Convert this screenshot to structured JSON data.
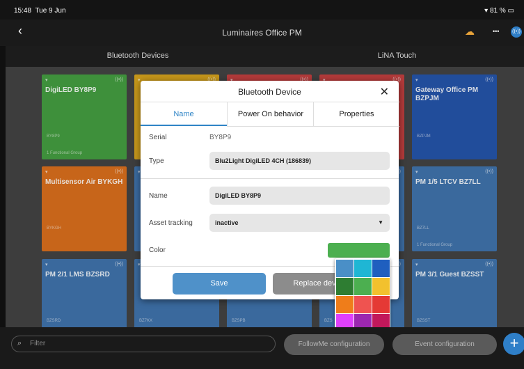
{
  "status_bar": {
    "time": "15:48",
    "date": "Tue 9 Jun",
    "battery": "81 %"
  },
  "header": {
    "title": "Luminaires Office PM",
    "back_icon": "chevron-left-icon",
    "more": "•••"
  },
  "tabs": [
    "Bluetooth Devices",
    "LiNA Touch"
  ],
  "tiles": [
    {
      "name": "DigiLED BY8P9",
      "serial": "BY8P9",
      "group": "1 Functional Group",
      "color": "#3f9a3b"
    },
    {
      "name": "",
      "serial": "",
      "group": "",
      "color": "#d4a017"
    },
    {
      "name": "",
      "serial": "",
      "group": "",
      "color": "#c03a3a"
    },
    {
      "name": "",
      "serial": "",
      "group": "",
      "color": "#c03a3a"
    },
    {
      "name": "Gateway Office PM BZPJM",
      "serial": "BZPJM",
      "group": "",
      "color": "#1f4fa6"
    },
    {
      "name": "Multisensor Air BYKGH",
      "serial": "BYKGH",
      "group": "",
      "color": "#d66a17"
    },
    {
      "name": "",
      "serial": "",
      "group": "",
      "color": "#3a6ea8"
    },
    {
      "name": "",
      "serial": "",
      "group": "",
      "color": "#3a6ea8"
    },
    {
      "name": "",
      "serial": "",
      "group": "",
      "color": "#3a6ea8"
    },
    {
      "name": "PM 1/5 LTCV BZ7LL",
      "serial": "BZ7LL",
      "group": "1 Functional Group",
      "color": "#3a6ea8"
    },
    {
      "name": "PM 2/1 LMS BZSRD",
      "serial": "BZSRD",
      "group": "",
      "color": "#3a6ea8"
    },
    {
      "name": "",
      "serial": "BZ7KX",
      "group": "",
      "color": "#3a6ea8"
    },
    {
      "name": "",
      "serial": "BZSPB",
      "group": "",
      "color": "#3a6ea8"
    },
    {
      "name": "",
      "serial": "BZS",
      "group": "",
      "color": "#3a6ea8"
    },
    {
      "name": "PM 3/1 Guest BZSST",
      "serial": "BZSST",
      "group": "",
      "color": "#3a6ea8"
    }
  ],
  "dialog": {
    "title": "Bluetooth Device",
    "close": "✕",
    "tabs": [
      "Name",
      "Power On behavior",
      "Properties"
    ],
    "serial_label": "Serial",
    "serial_value": "BY8P9",
    "type_label": "Type",
    "type_value": "Blu2Light DigiLED 4CH (186839)",
    "name_label": "Name",
    "name_value": "DigiLED BY8P9",
    "asset_label": "Asset tracking",
    "asset_value": "inactive",
    "color_label": "Color",
    "color_value": "#4caf50",
    "save": "Save",
    "replace": "Replace dev"
  },
  "palette": [
    "#4a8fc7",
    "#1fb6d4",
    "#1f5fbf",
    "#2e7d32",
    "#4caf50",
    "#f2c12e",
    "#ef7d1a",
    "#ef5350",
    "#e53935",
    "#e040fb",
    "#9c27b0",
    "#c2185b"
  ],
  "bottom": {
    "filter_placeholder": "Filter",
    "followme": "FollowMe configuration",
    "event": "Event configuration",
    "plus": "+"
  }
}
